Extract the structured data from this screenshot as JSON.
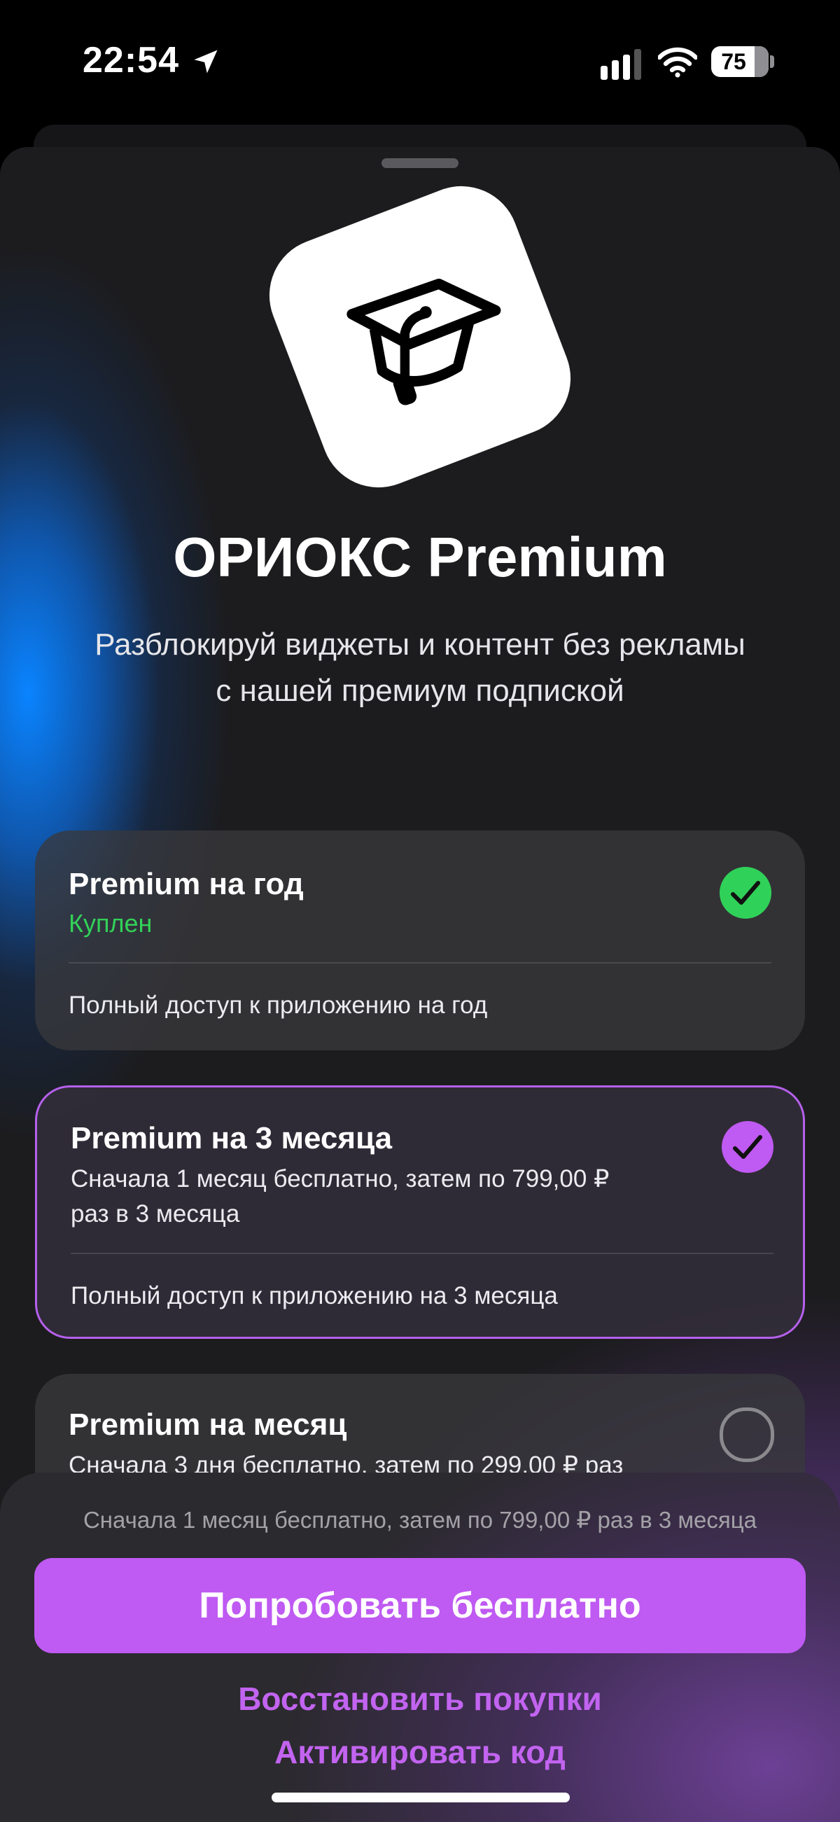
{
  "status_bar": {
    "time": "22:54",
    "battery": "75",
    "icons": [
      "location-arrow-icon",
      "cellular-signal-icon",
      "wifi-icon",
      "battery-icon"
    ]
  },
  "hero": {
    "app_icon": "graduation-cap-icon",
    "title": "ОРИОКС Premium",
    "subtitle_line1": "Разблокируй виджеты и контент без рекламы",
    "subtitle_line2": "с нашей премиум подпиской"
  },
  "plans": [
    {
      "title": "Premium на год",
      "status": "Куплен",
      "description": "Полный доступ к приложению на год",
      "state": "purchased"
    },
    {
      "title": "Premium на 3 месяца",
      "offer_line1": "Сначала 1 месяц бесплатно, затем по 799,00 ₽",
      "offer_line2": "раз в 3 месяца",
      "description": "Полный доступ к приложению на 3 месяца",
      "state": "selected"
    },
    {
      "title": "Premium на месяц",
      "offer_line1": "Сначала 3 дня бесплатно, затем по 299,00 ₽ раз",
      "state": "unselected"
    }
  ],
  "footer": {
    "terms": "Сначала 1 месяц бесплатно, затем по 799,00 ₽ раз в 3 месяца",
    "cta_label": "Попробовать бесплатно",
    "restore_label": "Восстановить покупки",
    "redeem_label": "Активировать код"
  },
  "colors": {
    "accent": "#bf5af2",
    "success": "#30d158",
    "background": "#1c1c1e"
  }
}
